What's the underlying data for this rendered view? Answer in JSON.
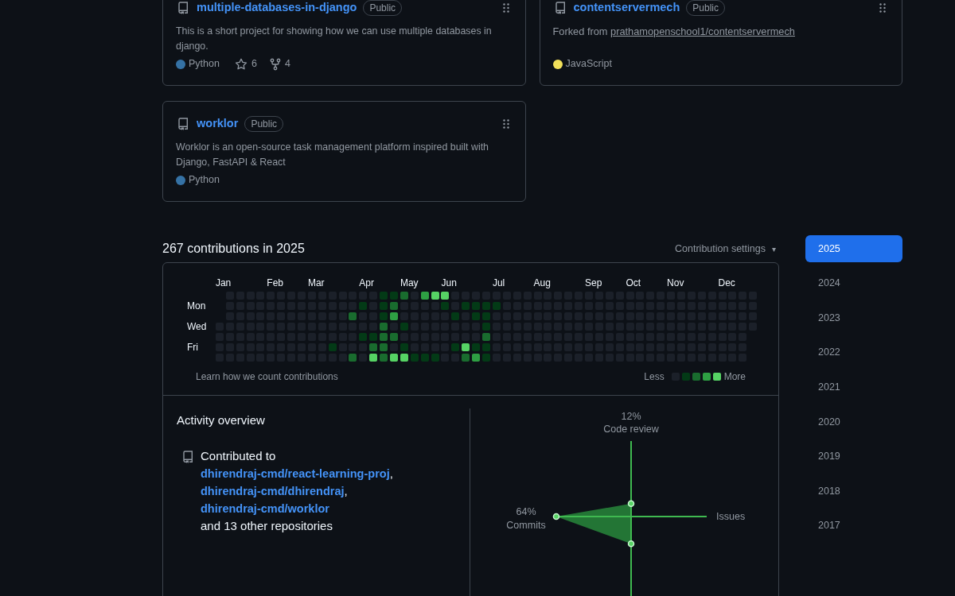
{
  "pinned": [
    {
      "name": "multiple-databases-in-django",
      "visibility": "Public",
      "description": "This is a short project for showing how we can use multiple databases in django.",
      "language": {
        "name": "Python",
        "color": "#3572a5"
      },
      "stars": "6",
      "forks": "4"
    },
    {
      "name": "contentservermech",
      "visibility": "Public",
      "forked_from": {
        "prefix": "Forked from",
        "repo": "prathamopenschool1/contentservermech"
      },
      "language": {
        "name": "JavaScript",
        "color": "#f1e05a"
      }
    },
    {
      "name": "worklor",
      "visibility": "Public",
      "description": "Worklor is an open-source task management platform inspired built with Django, FastAPI & React",
      "language": {
        "name": "Python",
        "color": "#3572a5"
      }
    }
  ],
  "contributions": {
    "heading": "267 contributions in 2025",
    "settings": "Contribution settings",
    "settings_caret": "▾",
    "months": [
      "Jan",
      "Feb",
      "Mar",
      "Apr",
      "May",
      "Jun",
      "Jul",
      "Aug",
      "Sep",
      "Oct",
      "Nov",
      "Dec"
    ],
    "rows": [
      {
        "cells": [
          {
            "kind": "none"
          },
          {
            "kind": "none"
          },
          {
            "kind": "none"
          },
          {
            "kind": "none"
          },
          {
            "kind": "none"
          },
          {
            "kind": "none"
          },
          {
            "kind": "none"
          },
          {
            "kind": "none"
          },
          {
            "kind": "none"
          },
          {
            "kind": "none"
          },
          {
            "kind": "none"
          },
          {
            "kind": "none"
          },
          {
            "kind": "none"
          },
          {
            "kind": "none"
          },
          {
            "kind": "none"
          },
          {
            "kind": "low"
          },
          {
            "kind": "low"
          },
          {
            "kind": "medium"
          },
          {
            "kind": "none"
          },
          {
            "kind": "high"
          },
          {
            "kind": "max"
          },
          {
            "kind": "max"
          },
          {
            "kind": "none"
          },
          {
            "kind": "none"
          },
          {
            "kind": "none"
          },
          {
            "kind": "none"
          },
          {
            "kind": "none"
          },
          {
            "kind": "none"
          },
          {
            "kind": "none"
          },
          {
            "kind": "none"
          },
          {
            "kind": "none"
          },
          {
            "kind": "none"
          },
          {
            "kind": "none"
          },
          {
            "kind": "none"
          },
          {
            "kind": "none"
          },
          {
            "kind": "none"
          },
          {
            "kind": "none"
          },
          {
            "kind": "none"
          },
          {
            "kind": "none"
          },
          {
            "kind": "none"
          },
          {
            "kind": "none"
          },
          {
            "kind": "none"
          },
          {
            "kind": "none"
          },
          {
            "kind": "none"
          },
          {
            "kind": "none"
          },
          {
            "kind": "none"
          },
          {
            "kind": "none"
          },
          {
            "kind": "none"
          },
          {
            "kind": "none"
          },
          {
            "kind": "none"
          },
          {
            "kind": "none"
          },
          {
            "kind": "none"
          }
        ]
      },
      {
        "label": "Mon",
        "cells": [
          {
            "kind": "none"
          },
          {
            "kind": "none"
          },
          {
            "kind": "none"
          },
          {
            "kind": "none"
          },
          {
            "kind": "none"
          },
          {
            "kind": "none"
          },
          {
            "kind": "none"
          },
          {
            "kind": "none"
          },
          {
            "kind": "none"
          },
          {
            "kind": "none"
          },
          {
            "kind": "none"
          },
          {
            "kind": "none"
          },
          {
            "kind": "none"
          },
          {
            "kind": "low"
          },
          {
            "kind": "none"
          },
          {
            "kind": "low"
          },
          {
            "kind": "medium"
          },
          {
            "kind": "none"
          },
          {
            "kind": "none"
          },
          {
            "kind": "none"
          },
          {
            "kind": "none"
          },
          {
            "kind": "low"
          },
          {
            "kind": "none"
          },
          {
            "kind": "low"
          },
          {
            "kind": "low"
          },
          {
            "kind": "low"
          },
          {
            "kind": "low"
          },
          {
            "kind": "none"
          },
          {
            "kind": "none"
          },
          {
            "kind": "none"
          },
          {
            "kind": "none"
          },
          {
            "kind": "none"
          },
          {
            "kind": "none"
          },
          {
            "kind": "none"
          },
          {
            "kind": "none"
          },
          {
            "kind": "none"
          },
          {
            "kind": "none"
          },
          {
            "kind": "none"
          },
          {
            "kind": "none"
          },
          {
            "kind": "none"
          },
          {
            "kind": "none"
          },
          {
            "kind": "none"
          },
          {
            "kind": "none"
          },
          {
            "kind": "none"
          },
          {
            "kind": "none"
          },
          {
            "kind": "none"
          },
          {
            "kind": "none"
          },
          {
            "kind": "none"
          },
          {
            "kind": "none"
          },
          {
            "kind": "none"
          },
          {
            "kind": "none"
          },
          {
            "kind": "none"
          }
        ]
      },
      {
        "cells": [
          {
            "kind": "none"
          },
          {
            "kind": "none"
          },
          {
            "kind": "none"
          },
          {
            "kind": "none"
          },
          {
            "kind": "none"
          },
          {
            "kind": "none"
          },
          {
            "kind": "none"
          },
          {
            "kind": "none"
          },
          {
            "kind": "none"
          },
          {
            "kind": "none"
          },
          {
            "kind": "none"
          },
          {
            "kind": "none"
          },
          {
            "kind": "medium"
          },
          {
            "kind": "none"
          },
          {
            "kind": "none"
          },
          {
            "kind": "low"
          },
          {
            "kind": "high"
          },
          {
            "kind": "none"
          },
          {
            "kind": "none"
          },
          {
            "kind": "none"
          },
          {
            "kind": "none"
          },
          {
            "kind": "none"
          },
          {
            "kind": "low"
          },
          {
            "kind": "none"
          },
          {
            "kind": "low"
          },
          {
            "kind": "low"
          },
          {
            "kind": "none"
          },
          {
            "kind": "none"
          },
          {
            "kind": "none"
          },
          {
            "kind": "none"
          },
          {
            "kind": "none"
          },
          {
            "kind": "none"
          },
          {
            "kind": "none"
          },
          {
            "kind": "none"
          },
          {
            "kind": "none"
          },
          {
            "kind": "none"
          },
          {
            "kind": "none"
          },
          {
            "kind": "none"
          },
          {
            "kind": "none"
          },
          {
            "kind": "none"
          },
          {
            "kind": "none"
          },
          {
            "kind": "none"
          },
          {
            "kind": "none"
          },
          {
            "kind": "none"
          },
          {
            "kind": "none"
          },
          {
            "kind": "none"
          },
          {
            "kind": "none"
          },
          {
            "kind": "none"
          },
          {
            "kind": "none"
          },
          {
            "kind": "none"
          },
          {
            "kind": "none"
          },
          {
            "kind": "none"
          }
        ]
      },
      {
        "label": "Wed",
        "cells": [
          {
            "kind": "none"
          },
          {
            "kind": "none"
          },
          {
            "kind": "none"
          },
          {
            "kind": "none"
          },
          {
            "kind": "none"
          },
          {
            "kind": "none"
          },
          {
            "kind": "none"
          },
          {
            "kind": "none"
          },
          {
            "kind": "none"
          },
          {
            "kind": "none"
          },
          {
            "kind": "none"
          },
          {
            "kind": "none"
          },
          {
            "kind": "none"
          },
          {
            "kind": "none"
          },
          {
            "kind": "none"
          },
          {
            "kind": "none"
          },
          {
            "kind": "medium"
          },
          {
            "kind": "none"
          },
          {
            "kind": "low"
          },
          {
            "kind": "none"
          },
          {
            "kind": "none"
          },
          {
            "kind": "none"
          },
          {
            "kind": "none"
          },
          {
            "kind": "none"
          },
          {
            "kind": "none"
          },
          {
            "kind": "none"
          },
          {
            "kind": "low"
          },
          {
            "kind": "none"
          },
          {
            "kind": "none"
          },
          {
            "kind": "none"
          },
          {
            "kind": "none"
          },
          {
            "kind": "none"
          },
          {
            "kind": "none"
          },
          {
            "kind": "none"
          },
          {
            "kind": "none"
          },
          {
            "kind": "none"
          },
          {
            "kind": "none"
          },
          {
            "kind": "none"
          },
          {
            "kind": "none"
          },
          {
            "kind": "none"
          },
          {
            "kind": "none"
          },
          {
            "kind": "none"
          },
          {
            "kind": "none"
          },
          {
            "kind": "none"
          },
          {
            "kind": "none"
          },
          {
            "kind": "none"
          },
          {
            "kind": "none"
          },
          {
            "kind": "none"
          },
          {
            "kind": "none"
          },
          {
            "kind": "none"
          },
          {
            "kind": "none"
          },
          {
            "kind": "none"
          },
          {
            "kind": "none"
          }
        ]
      },
      {
        "cells": [
          {
            "kind": "none"
          },
          {
            "kind": "none"
          },
          {
            "kind": "none"
          },
          {
            "kind": "none"
          },
          {
            "kind": "none"
          },
          {
            "kind": "none"
          },
          {
            "kind": "none"
          },
          {
            "kind": "none"
          },
          {
            "kind": "none"
          },
          {
            "kind": "none"
          },
          {
            "kind": "none"
          },
          {
            "kind": "none"
          },
          {
            "kind": "none"
          },
          {
            "kind": "none"
          },
          {
            "kind": "low"
          },
          {
            "kind": "low"
          },
          {
            "kind": "medium"
          },
          {
            "kind": "medium"
          },
          {
            "kind": "none"
          },
          {
            "kind": "none"
          },
          {
            "kind": "none"
          },
          {
            "kind": "none"
          },
          {
            "kind": "none"
          },
          {
            "kind": "none"
          },
          {
            "kind": "none"
          },
          {
            "kind": "none"
          },
          {
            "kind": "medium"
          },
          {
            "kind": "none"
          },
          {
            "kind": "none"
          },
          {
            "kind": "none"
          },
          {
            "kind": "none"
          },
          {
            "kind": "none"
          },
          {
            "kind": "none"
          },
          {
            "kind": "none"
          },
          {
            "kind": "none"
          },
          {
            "kind": "none"
          },
          {
            "kind": "none"
          },
          {
            "kind": "none"
          },
          {
            "kind": "none"
          },
          {
            "kind": "none"
          },
          {
            "kind": "none"
          },
          {
            "kind": "none"
          },
          {
            "kind": "none"
          },
          {
            "kind": "none"
          },
          {
            "kind": "none"
          },
          {
            "kind": "none"
          },
          {
            "kind": "none"
          },
          {
            "kind": "none"
          },
          {
            "kind": "none"
          },
          {
            "kind": "none"
          },
          {
            "kind": "none"
          },
          {
            "kind": "none"
          }
        ]
      },
      {
        "label": "Fri",
        "cells": [
          {
            "kind": "none"
          },
          {
            "kind": "none"
          },
          {
            "kind": "none"
          },
          {
            "kind": "none"
          },
          {
            "kind": "none"
          },
          {
            "kind": "none"
          },
          {
            "kind": "none"
          },
          {
            "kind": "none"
          },
          {
            "kind": "none"
          },
          {
            "kind": "none"
          },
          {
            "kind": "none"
          },
          {
            "kind": "low"
          },
          {
            "kind": "none"
          },
          {
            "kind": "none"
          },
          {
            "kind": "none"
          },
          {
            "kind": "medium"
          },
          {
            "kind": "medium"
          },
          {
            "kind": "none"
          },
          {
            "kind": "low"
          },
          {
            "kind": "none"
          },
          {
            "kind": "none"
          },
          {
            "kind": "none"
          },
          {
            "kind": "none"
          },
          {
            "kind": "low"
          },
          {
            "kind": "max"
          },
          {
            "kind": "low"
          },
          {
            "kind": "low"
          },
          {
            "kind": "none"
          },
          {
            "kind": "none"
          },
          {
            "kind": "none"
          },
          {
            "kind": "none"
          },
          {
            "kind": "none"
          },
          {
            "kind": "none"
          },
          {
            "kind": "none"
          },
          {
            "kind": "none"
          },
          {
            "kind": "none"
          },
          {
            "kind": "none"
          },
          {
            "kind": "none"
          },
          {
            "kind": "none"
          },
          {
            "kind": "none"
          },
          {
            "kind": "none"
          },
          {
            "kind": "none"
          },
          {
            "kind": "none"
          },
          {
            "kind": "none"
          },
          {
            "kind": "none"
          },
          {
            "kind": "none"
          },
          {
            "kind": "none"
          },
          {
            "kind": "none"
          },
          {
            "kind": "none"
          },
          {
            "kind": "none"
          },
          {
            "kind": "none"
          },
          {
            "kind": "none"
          }
        ]
      },
      {
        "cells": [
          {
            "kind": "none"
          },
          {
            "kind": "none"
          },
          {
            "kind": "none"
          },
          {
            "kind": "none"
          },
          {
            "kind": "none"
          },
          {
            "kind": "none"
          },
          {
            "kind": "none"
          },
          {
            "kind": "none"
          },
          {
            "kind": "none"
          },
          {
            "kind": "none"
          },
          {
            "kind": "none"
          },
          {
            "kind": "none"
          },
          {
            "kind": "none"
          },
          {
            "kind": "medium"
          },
          {
            "kind": "none"
          },
          {
            "kind": "max"
          },
          {
            "kind": "medium"
          },
          {
            "kind": "max"
          },
          {
            "kind": "max"
          },
          {
            "kind": "low"
          },
          {
            "kind": "low"
          },
          {
            "kind": "low"
          },
          {
            "kind": "none"
          },
          {
            "kind": "none"
          },
          {
            "kind": "medium"
          },
          {
            "kind": "high"
          },
          {
            "kind": "low"
          },
          {
            "kind": "none"
          },
          {
            "kind": "none"
          },
          {
            "kind": "none"
          },
          {
            "kind": "none"
          },
          {
            "kind": "none"
          },
          {
            "kind": "none"
          },
          {
            "kind": "none"
          },
          {
            "kind": "none"
          },
          {
            "kind": "none"
          },
          {
            "kind": "none"
          },
          {
            "kind": "none"
          },
          {
            "kind": "none"
          },
          {
            "kind": "none"
          },
          {
            "kind": "none"
          },
          {
            "kind": "none"
          },
          {
            "kind": "none"
          },
          {
            "kind": "none"
          },
          {
            "kind": "none"
          },
          {
            "kind": "none"
          },
          {
            "kind": "none"
          },
          {
            "kind": "none"
          },
          {
            "kind": "none"
          },
          {
            "kind": "none"
          },
          {
            "kind": "none"
          },
          {
            "kind": "none"
          }
        ]
      }
    ],
    "learn_link": "Learn how we count contributions",
    "legend_less": "Less",
    "legend_more": "More"
  },
  "activity": {
    "title": "Activity overview",
    "prefix": "Contributed to",
    "repos": [
      {
        "name": "dhirendraj-cmd/react-learning-proj",
        "separator": ","
      },
      {
        "name": "dhirendraj-cmd/dhirendraj",
        "separator": ","
      },
      {
        "name": "dhirendraj-cmd/worklor"
      }
    ],
    "suffix": "and 13 other repositories",
    "axes": [
      {
        "label": "Code review",
        "reading": "12%"
      },
      {
        "label": "Issues"
      },
      {
        "label": "Commits",
        "reading": "64%"
      }
    ]
  },
  "years": [
    {
      "label": "2025",
      "selected": true
    },
    {
      "label": "2024",
      "selected": false
    },
    {
      "label": "2023",
      "selected": false
    },
    {
      "label": "2022",
      "selected": false
    },
    {
      "label": "2021",
      "selected": false
    },
    {
      "label": "2020",
      "selected": false
    },
    {
      "label": "2019",
      "selected": false
    },
    {
      "label": "2018",
      "selected": false
    },
    {
      "label": "2017",
      "selected": false
    }
  ]
}
